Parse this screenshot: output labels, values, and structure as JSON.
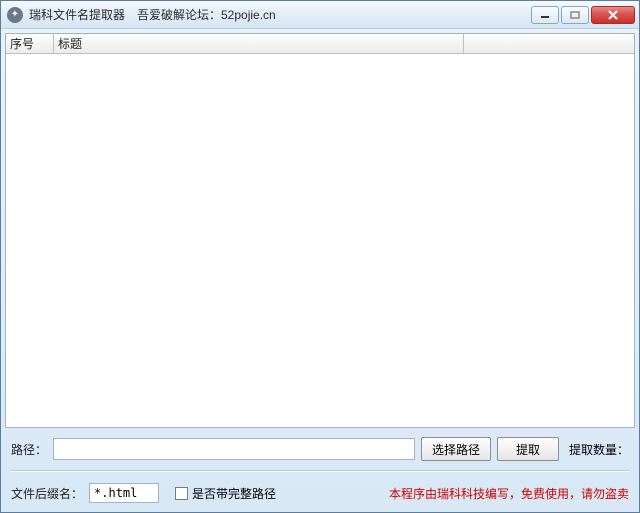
{
  "window": {
    "title": "瑞科文件名提取器　吾爱破解论坛：52pojie.cn"
  },
  "list": {
    "columns": {
      "index": "序号",
      "title": "标题",
      "extra": ""
    },
    "rows": []
  },
  "path": {
    "label": "路径：",
    "value": "",
    "browse_btn": "选择路径",
    "extract_btn": "提取",
    "count_label": "提取数量："
  },
  "options": {
    "ext_label": "文件后缀名：",
    "ext_value": "*.html",
    "fullpath_label": "是否带完整路径",
    "fullpath_checked": false,
    "credit": "本程序由瑞科科技编写，免费使用，请勿盗卖"
  }
}
